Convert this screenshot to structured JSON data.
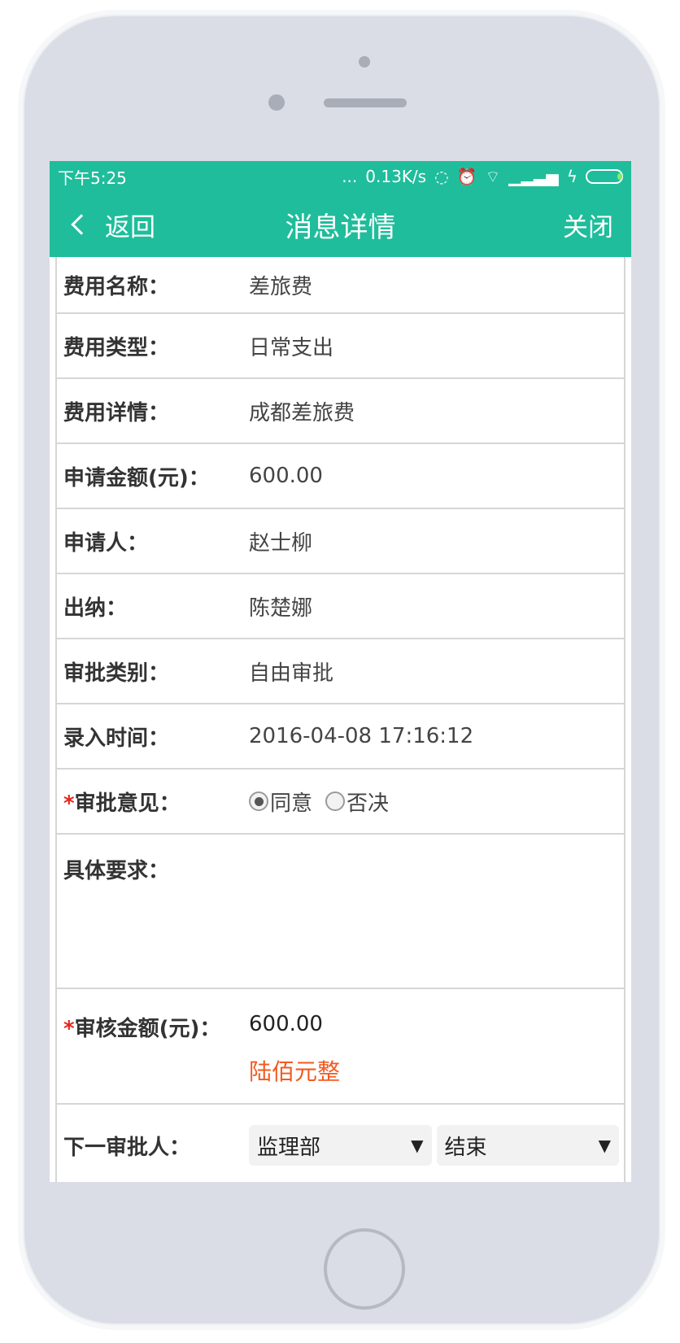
{
  "status": {
    "time": "下午5:25",
    "network_speed": "0.13K/s",
    "icons": [
      "more-dots-icon",
      "sync-icon",
      "alarm-icon",
      "wifi-icon",
      "signal-icon",
      "charging-icon",
      "battery-icon"
    ],
    "dots": "...",
    "sync": "◌",
    "alarm": "⏰",
    "wifi": "⌔",
    "signal": "▁▂▃▅",
    "charge": "ϟ"
  },
  "nav": {
    "back_label": "返回",
    "title": "消息详情",
    "close_label": "关闭"
  },
  "fields": [
    {
      "label": "费用名称：",
      "value": "差旅费"
    },
    {
      "label": "费用类型：",
      "value": "日常支出"
    },
    {
      "label": "费用详情：",
      "value": "成都差旅费"
    },
    {
      "label": "申请金额(元)：",
      "value": "600.00"
    },
    {
      "label": "申请人：",
      "value": "赵士柳"
    },
    {
      "label": "出纳：",
      "value": "陈楚娜"
    },
    {
      "label": "审批类别：",
      "value": "自由审批"
    },
    {
      "label": "录入时间：",
      "value": "2016-04-08 17:16:12"
    }
  ],
  "opinion": {
    "required_mark": "*",
    "label": "审批意见：",
    "options": [
      "同意",
      "否决"
    ],
    "selected": "同意"
  },
  "requirement": {
    "label": "具体要求：",
    "value": ""
  },
  "approved_amount": {
    "required_mark": "*",
    "label": "审核金额(元)：",
    "value": "600.00",
    "uppercase": "陆佰元整"
  },
  "next_approver": {
    "label": "下一审批人：",
    "department": "监理部",
    "person": "结束",
    "arrow": "▼"
  },
  "colors": {
    "header": "#1fbd9b",
    "required": "#e8251f",
    "amount_upper": "#f25a1f"
  }
}
